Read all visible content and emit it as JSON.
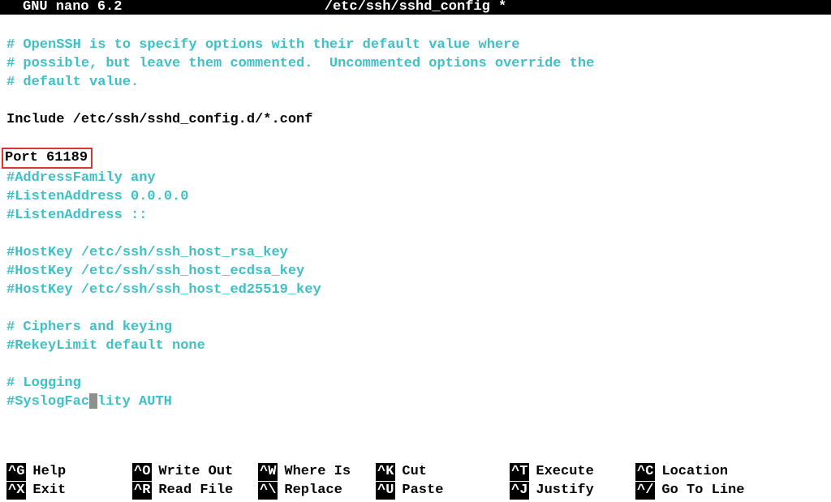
{
  "titlebar": {
    "app": "GNU nano 6.2",
    "filename": "/etc/ssh/sshd_config *"
  },
  "lines": {
    "l1": "# OpenSSH is to specify options with their default value where",
    "l2": "# possible, but leave them commented.  Uncommented options override the",
    "l3": "# default value.",
    "l4": "",
    "l5": "Include /etc/ssh/sshd_config.d/*.conf",
    "l6": "",
    "l7_highlighted": "Port 61189",
    "l8": "#AddressFamily any",
    "l9": "#ListenAddress 0.0.0.0",
    "l10": "#ListenAddress ::",
    "l11": "",
    "l12": "#HostKey /etc/ssh/ssh_host_rsa_key",
    "l13": "#HostKey /etc/ssh/ssh_host_ecdsa_key",
    "l14": "#HostKey /etc/ssh/ssh_host_ed25519_key",
    "l15": "",
    "l16": "# Ciphers and keying",
    "l17": "#RekeyLimit default none",
    "l18": "",
    "l19": "# Logging",
    "l20_pre": "#SyslogFac",
    "l20_post": "lity AUTH"
  },
  "shortcuts": {
    "row1": {
      "k1": "^G",
      "v1": "Help",
      "k2": "^O",
      "v2": "Write Out",
      "k3": "^W",
      "v3": "Where Is",
      "k4": "^K",
      "v4": "Cut",
      "k5": "^T",
      "v5": "Execute",
      "k6": "^C",
      "v6": "Location"
    },
    "row2": {
      "k1": "^X",
      "v1": "Exit",
      "k2": "^R",
      "v2": "Read File",
      "k3": "^\\",
      "v3": "Replace",
      "k4": "^U",
      "v4": "Paste",
      "k5": "^J",
      "v5": "Justify",
      "k6": "^/",
      "v6": "Go To Line"
    }
  }
}
